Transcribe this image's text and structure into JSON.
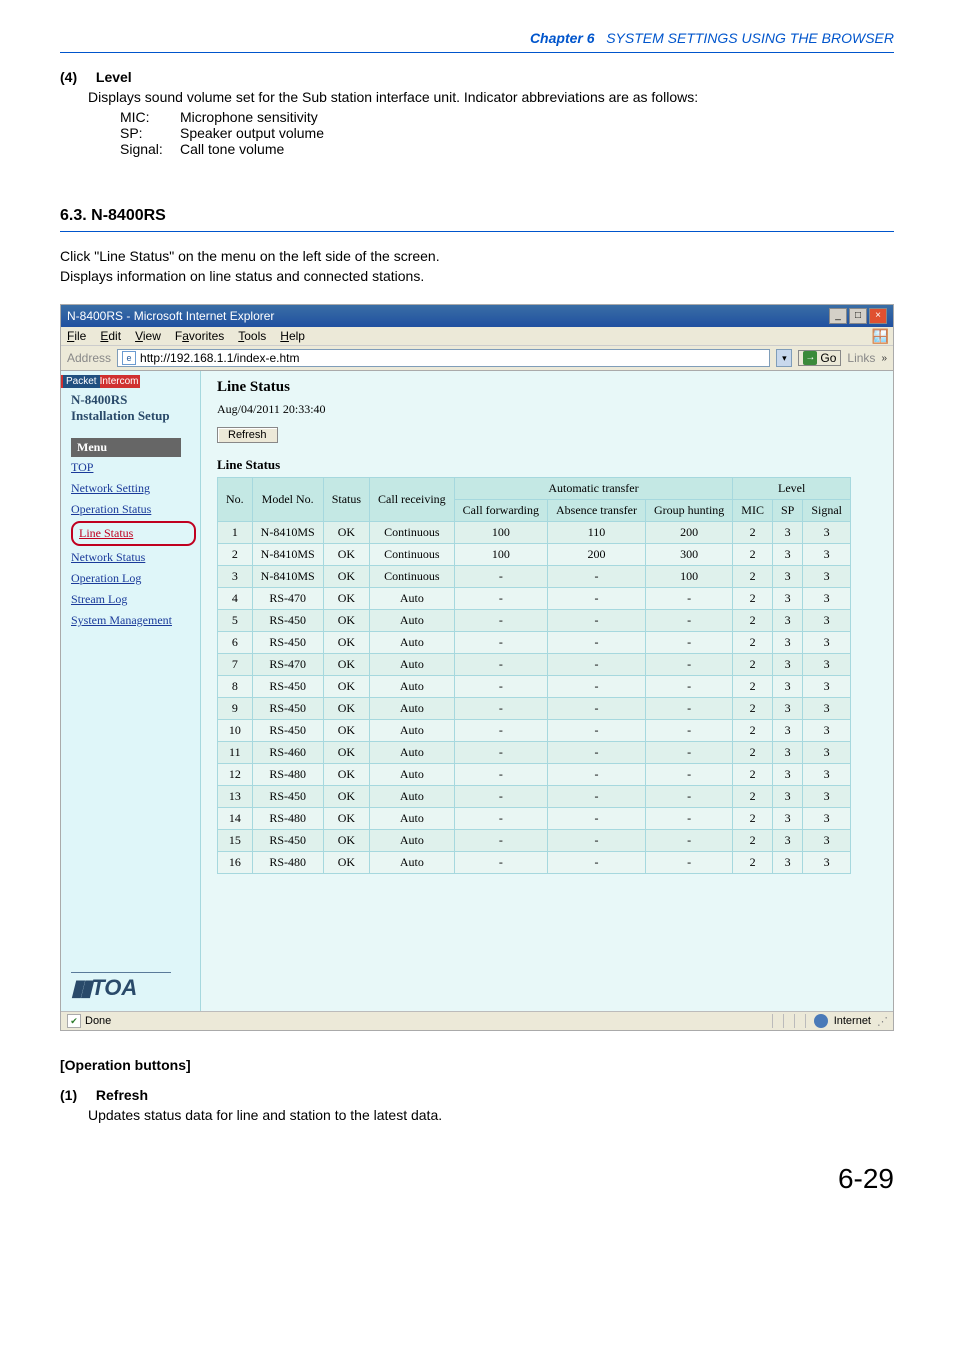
{
  "chapter": {
    "label": "Chapter 6",
    "title": "SYSTEM SETTINGS USING THE BROWSER"
  },
  "section4": {
    "num": "(4)",
    "title": "Level",
    "desc": "Displays sound volume set for the Sub station interface unit. Indicator abbreviations are as follows:",
    "defs": [
      {
        "term": "MIC:",
        "val": "Microphone sensitivity"
      },
      {
        "term": "SP:",
        "val": "Speaker output volume"
      },
      {
        "term": "Signal:",
        "val": "Call tone volume"
      }
    ]
  },
  "section63": {
    "heading": "6.3. N-8400RS",
    "p1": "Click \"Line Status\" on the menu on the left side of the screen.",
    "p2": "Displays information on line status and connected stations."
  },
  "op_hdr": "[Operation buttons]",
  "refresh_section": {
    "num": "(1)",
    "title": "Refresh",
    "desc": "Updates status data for line and station to the latest data."
  },
  "page_num": "6-29",
  "browser": {
    "title": "N-8400RS - Microsoft Internet Explorer",
    "menus": [
      "File",
      "Edit",
      "View",
      "Favorites",
      "Tools",
      "Help"
    ],
    "address_label": "Address",
    "url": "http://192.168.1.1/index-e.htm",
    "go_label": "Go",
    "links_label": "Links",
    "status_done": "Done",
    "status_zone": "Internet"
  },
  "sidebar": {
    "banner_pre": "Packet",
    "banner_post": "Intercom",
    "model": "N-8400RS",
    "install": "Installation Setup",
    "menu_hdr": "Menu",
    "items": [
      {
        "label": "TOP"
      },
      {
        "label": "Network Setting"
      },
      {
        "label": "Operation Status"
      },
      {
        "label": "Line Status",
        "active": true
      },
      {
        "label": "Network Status"
      },
      {
        "label": "Operation Log"
      },
      {
        "label": "Stream Log"
      },
      {
        "label": "System Management"
      }
    ],
    "logo": "TOA"
  },
  "main": {
    "heading": "Line Status",
    "timestamp": "Aug/04/2011 20:33:40",
    "refresh": "Refresh",
    "subheading": "Line Status",
    "columns": {
      "no": "No.",
      "model": "Model No.",
      "status": "Status",
      "call_recv": "Call receiving",
      "auto_group": "Automatic transfer",
      "call_fwd": "Call forwarding",
      "abs_trans": "Absence transfer",
      "grp_hunt": "Group hunting",
      "level_group": "Level",
      "mic": "MIC",
      "sp": "SP",
      "signal": "Signal"
    },
    "rows": [
      {
        "no": 1,
        "model": "N-8410MS",
        "status": "OK",
        "recv": "Continuous",
        "cf": "100",
        "at": "110",
        "gh": "200",
        "mic": 2,
        "sp": 3,
        "sig": 3
      },
      {
        "no": 2,
        "model": "N-8410MS",
        "status": "OK",
        "recv": "Continuous",
        "cf": "100",
        "at": "200",
        "gh": "300",
        "mic": 2,
        "sp": 3,
        "sig": 3
      },
      {
        "no": 3,
        "model": "N-8410MS",
        "status": "OK",
        "recv": "Continuous",
        "cf": "-",
        "at": "-",
        "gh": "100",
        "mic": 2,
        "sp": 3,
        "sig": 3
      },
      {
        "no": 4,
        "model": "RS-470",
        "status": "OK",
        "recv": "Auto",
        "cf": "-",
        "at": "-",
        "gh": "-",
        "mic": 2,
        "sp": 3,
        "sig": 3
      },
      {
        "no": 5,
        "model": "RS-450",
        "status": "OK",
        "recv": "Auto",
        "cf": "-",
        "at": "-",
        "gh": "-",
        "mic": 2,
        "sp": 3,
        "sig": 3
      },
      {
        "no": 6,
        "model": "RS-450",
        "status": "OK",
        "recv": "Auto",
        "cf": "-",
        "at": "-",
        "gh": "-",
        "mic": 2,
        "sp": 3,
        "sig": 3
      },
      {
        "no": 7,
        "model": "RS-470",
        "status": "OK",
        "recv": "Auto",
        "cf": "-",
        "at": "-",
        "gh": "-",
        "mic": 2,
        "sp": 3,
        "sig": 3
      },
      {
        "no": 8,
        "model": "RS-450",
        "status": "OK",
        "recv": "Auto",
        "cf": "-",
        "at": "-",
        "gh": "-",
        "mic": 2,
        "sp": 3,
        "sig": 3
      },
      {
        "no": 9,
        "model": "RS-450",
        "status": "OK",
        "recv": "Auto",
        "cf": "-",
        "at": "-",
        "gh": "-",
        "mic": 2,
        "sp": 3,
        "sig": 3
      },
      {
        "no": 10,
        "model": "RS-450",
        "status": "OK",
        "recv": "Auto",
        "cf": "-",
        "at": "-",
        "gh": "-",
        "mic": 2,
        "sp": 3,
        "sig": 3
      },
      {
        "no": 11,
        "model": "RS-460",
        "status": "OK",
        "recv": "Auto",
        "cf": "-",
        "at": "-",
        "gh": "-",
        "mic": 2,
        "sp": 3,
        "sig": 3
      },
      {
        "no": 12,
        "model": "RS-480",
        "status": "OK",
        "recv": "Auto",
        "cf": "-",
        "at": "-",
        "gh": "-",
        "mic": 2,
        "sp": 3,
        "sig": 3
      },
      {
        "no": 13,
        "model": "RS-450",
        "status": "OK",
        "recv": "Auto",
        "cf": "-",
        "at": "-",
        "gh": "-",
        "mic": 2,
        "sp": 3,
        "sig": 3
      },
      {
        "no": 14,
        "model": "RS-480",
        "status": "OK",
        "recv": "Auto",
        "cf": "-",
        "at": "-",
        "gh": "-",
        "mic": 2,
        "sp": 3,
        "sig": 3
      },
      {
        "no": 15,
        "model": "RS-450",
        "status": "OK",
        "recv": "Auto",
        "cf": "-",
        "at": "-",
        "gh": "-",
        "mic": 2,
        "sp": 3,
        "sig": 3
      },
      {
        "no": 16,
        "model": "RS-480",
        "status": "OK",
        "recv": "Auto",
        "cf": "-",
        "at": "-",
        "gh": "-",
        "mic": 2,
        "sp": 3,
        "sig": 3
      }
    ]
  }
}
